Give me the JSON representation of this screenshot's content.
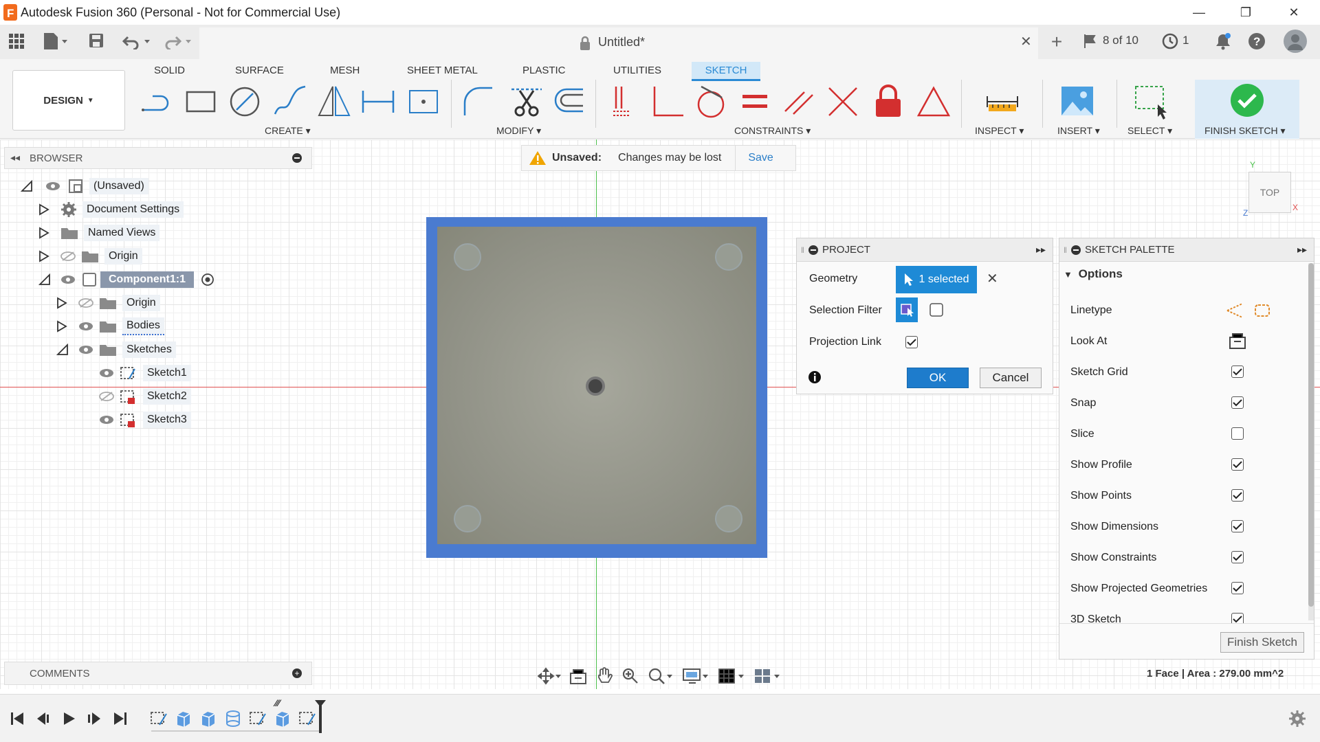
{
  "window": {
    "title": "Autodesk Fusion 360 (Personal - Not for Commercial Use)",
    "minimize": "—",
    "restore": "❐",
    "close": "✕"
  },
  "doc_tab": {
    "title": "Untitled*",
    "close": "✕",
    "job_status": "8 of 10",
    "clock_count": "1"
  },
  "ribbon": {
    "tabs": [
      "SOLID",
      "SURFACE",
      "MESH",
      "SHEET METAL",
      "PLASTIC",
      "UTILITIES",
      "SKETCH"
    ],
    "active_tab": "SKETCH",
    "workspace": "DESIGN",
    "groups": {
      "create": "CREATE",
      "modify": "MODIFY",
      "constraints": "CONSTRAINTS",
      "inspect": "INSPECT",
      "insert": "INSERT",
      "select": "SELECT",
      "finish": "FINISH SKETCH"
    }
  },
  "unsaved": {
    "label": "Unsaved:",
    "message": "Changes may be lost",
    "save": "Save"
  },
  "browser": {
    "header": "BROWSER",
    "items": [
      {
        "label": "(Unsaved)"
      },
      {
        "label": "Document Settings"
      },
      {
        "label": "Named Views"
      },
      {
        "label": "Origin"
      },
      {
        "label": "Component1:1"
      },
      {
        "label": "Origin"
      },
      {
        "label": "Bodies"
      },
      {
        "label": "Sketches"
      },
      {
        "label": "Sketch1"
      },
      {
        "label": "Sketch2"
      },
      {
        "label": "Sketch3"
      }
    ]
  },
  "viewcube": {
    "face": "TOP",
    "axis_y": "Y",
    "axis_x": "X",
    "axis_z": "Z"
  },
  "project": {
    "title": "PROJECT",
    "geometry_label": "Geometry",
    "geometry_value": "1 selected",
    "filter_label": "Selection Filter",
    "link_label": "Projection Link",
    "link_checked": true,
    "ok": "OK",
    "cancel": "Cancel"
  },
  "palette": {
    "title": "SKETCH PALETTE",
    "section": "Options",
    "linetype_label": "Linetype",
    "lookat_label": "Look At",
    "options": [
      {
        "label": "Sketch Grid",
        "checked": true
      },
      {
        "label": "Snap",
        "checked": true
      },
      {
        "label": "Slice",
        "checked": false
      },
      {
        "label": "Show Profile",
        "checked": true
      },
      {
        "label": "Show Points",
        "checked": true
      },
      {
        "label": "Show Dimensions",
        "checked": true
      },
      {
        "label": "Show Constraints",
        "checked": true
      },
      {
        "label": "Show Projected Geometries",
        "checked": true
      },
      {
        "label": "3D Sketch",
        "checked": true
      }
    ],
    "finish_button": "Finish Sketch"
  },
  "comments": {
    "header": "COMMENTS"
  },
  "status": {
    "selection_info": "1 Face | Area : 279.00 mm^2"
  }
}
